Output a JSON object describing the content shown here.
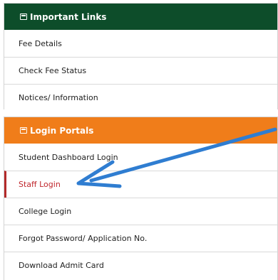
{
  "important_links": {
    "title": "Important Links",
    "items": [
      "Fee Details",
      "Check Fee Status",
      "Notices/ Information"
    ]
  },
  "login_portals": {
    "title": "Login Portals",
    "items": [
      "Student Dashboard Login",
      "Staff Login",
      "College Login",
      "Forgot Password/ Application No.",
      "Download Admit Card"
    ],
    "highlighted_item": "Staff Login"
  },
  "colors": {
    "important_links_header": "#0d4d2a",
    "login_portals_header": "#f07d1a",
    "highlight_text": "#c0272d",
    "arrow": "#2f7dd1"
  },
  "icons": [
    "calendar-icon",
    "arrow-annotation"
  ]
}
